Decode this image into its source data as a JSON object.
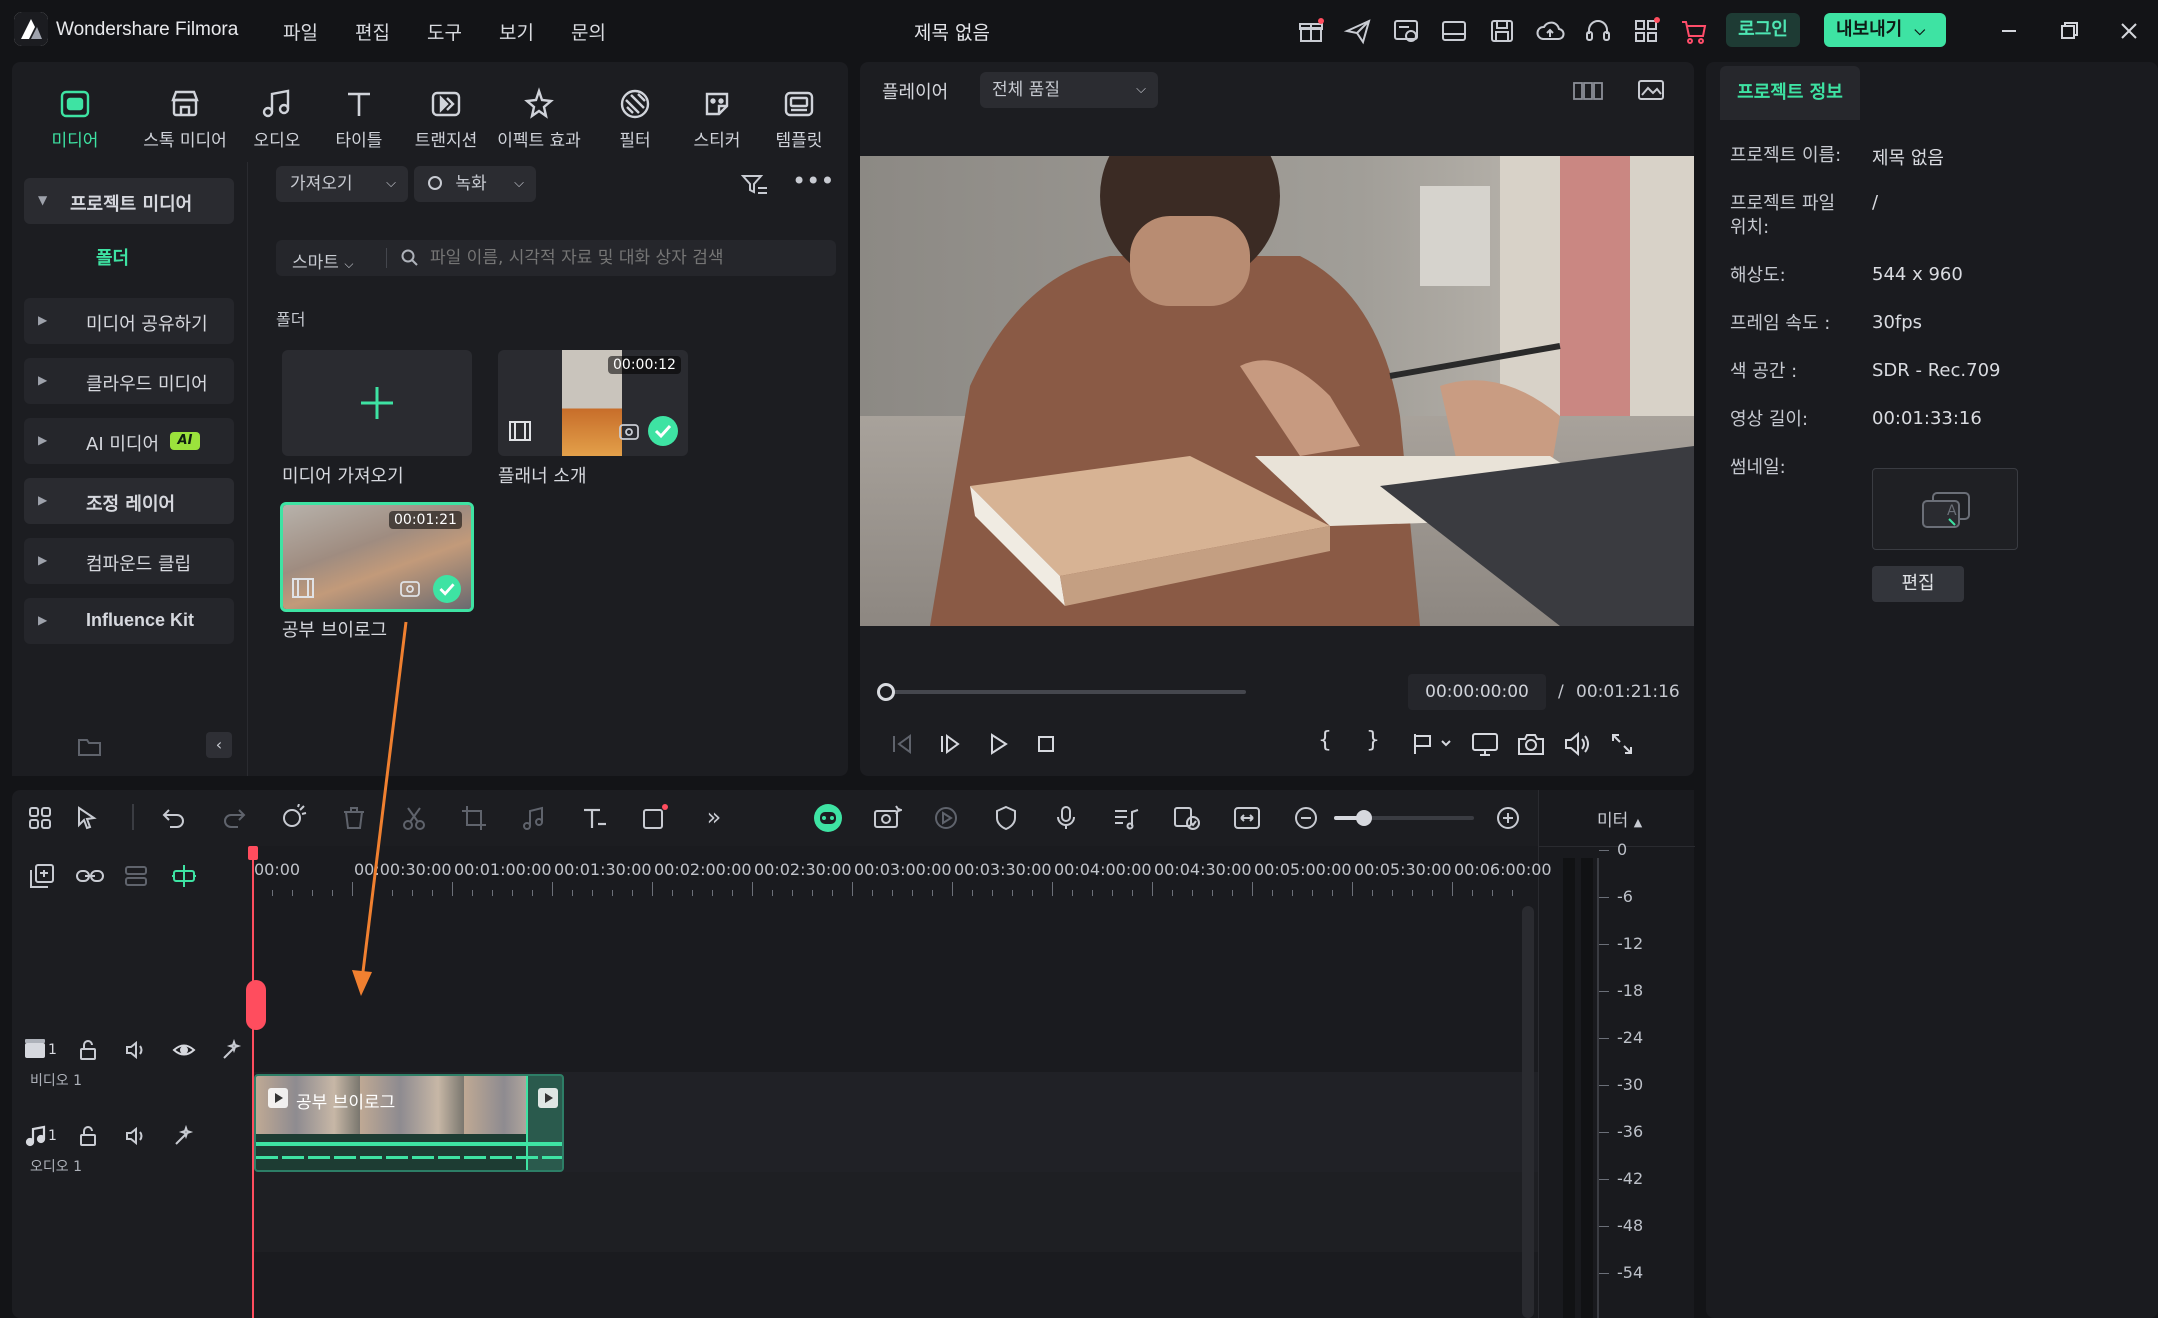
{
  "app": {
    "name": "Wondershare Filmora",
    "document_title": "제목 없음"
  },
  "menu": [
    "파일",
    "편집",
    "도구",
    "보기",
    "문의"
  ],
  "titlebar": {
    "login": "로그인",
    "export": "내보내기"
  },
  "categories": [
    {
      "label": "미디어",
      "icon": "media-icon",
      "active": true
    },
    {
      "label": "스톡 미디어",
      "icon": "stock-media-icon"
    },
    {
      "label": "오디오",
      "icon": "audio-icon"
    },
    {
      "label": "타이틀",
      "icon": "title-icon"
    },
    {
      "label": "트랜지션",
      "icon": "transition-icon"
    },
    {
      "label": "이펙트 효과",
      "icon": "effects-icon"
    },
    {
      "label": "필터",
      "icon": "filter-icon"
    },
    {
      "label": "스티커",
      "icon": "sticker-icon"
    },
    {
      "label": "템플릿",
      "icon": "template-icon"
    }
  ],
  "sidebar": {
    "project_media": "프로젝트 미디어",
    "folder": "폴더",
    "items": [
      "미디어 공유하기",
      "클라우드 미디어",
      "AI 미디어",
      "조정 레이어",
      "컴파운드 클립",
      "Influence Kit"
    ],
    "ai_badge": "AI"
  },
  "media_toolbar": {
    "import": "가져오기",
    "record": "녹화",
    "smart": "스마트",
    "search_placeholder": "파일 이름, 시각적 자료 및 대화 상자 검색",
    "folder_label": "폴더"
  },
  "media_items": [
    {
      "caption": "미디어 가져오기"
    },
    {
      "caption": "플래너 소개",
      "duration": "00:00:12"
    },
    {
      "caption": "공부 브이로그",
      "duration": "00:01:21"
    }
  ],
  "player": {
    "label": "플레이어",
    "quality": "전체 품질",
    "current_time": "00:00:00:00",
    "separator": "/",
    "total_time": "00:01:21:16",
    "progress": 0.0
  },
  "project_info": {
    "tab": "프로젝트 정보",
    "rows": [
      {
        "label": "프로젝트 이름:",
        "value": "제목 없음"
      },
      {
        "label": "프로젝트 파일\n위치:",
        "value": "/"
      },
      {
        "label": "해상도:",
        "value": "544 x 960"
      },
      {
        "label": "프레임 속도 :",
        "value": "30fps"
      },
      {
        "label": "색 공간 :",
        "value": "SDR - Rec.709"
      },
      {
        "label": "영상 길이:",
        "value": "00:01:33:16"
      },
      {
        "label": "썸네일:",
        "value": ""
      }
    ],
    "edit": "편집"
  },
  "timeline": {
    "ruler": [
      "00:00",
      "00:00:30:00",
      "00:01:00:00",
      "00:01:30:00",
      "00:02:00:00",
      "00:02:30:00",
      "00:03:00:00",
      "00:03:30:00",
      "00:04:00:00",
      "00:04:30:00",
      "00:05:00:00",
      "00:05:30:00",
      "00:06:00:00"
    ],
    "meter_label": "미터",
    "meter_scale": [
      "0",
      "-6",
      "-12",
      "-18",
      "-24",
      "-30",
      "-36",
      "-42",
      "-48",
      "-54"
    ],
    "tracks": [
      {
        "num": "1",
        "name": "비디오 1"
      },
      {
        "num": "1",
        "name": "오디오 1"
      }
    ],
    "clip_title": "공부 브이로그"
  },
  "colors": {
    "accent": "#3ee3a3",
    "playhead": "#ff4d5e",
    "arrow": "#f08030",
    "bg": "#131417",
    "panel": "#1c1d21"
  }
}
